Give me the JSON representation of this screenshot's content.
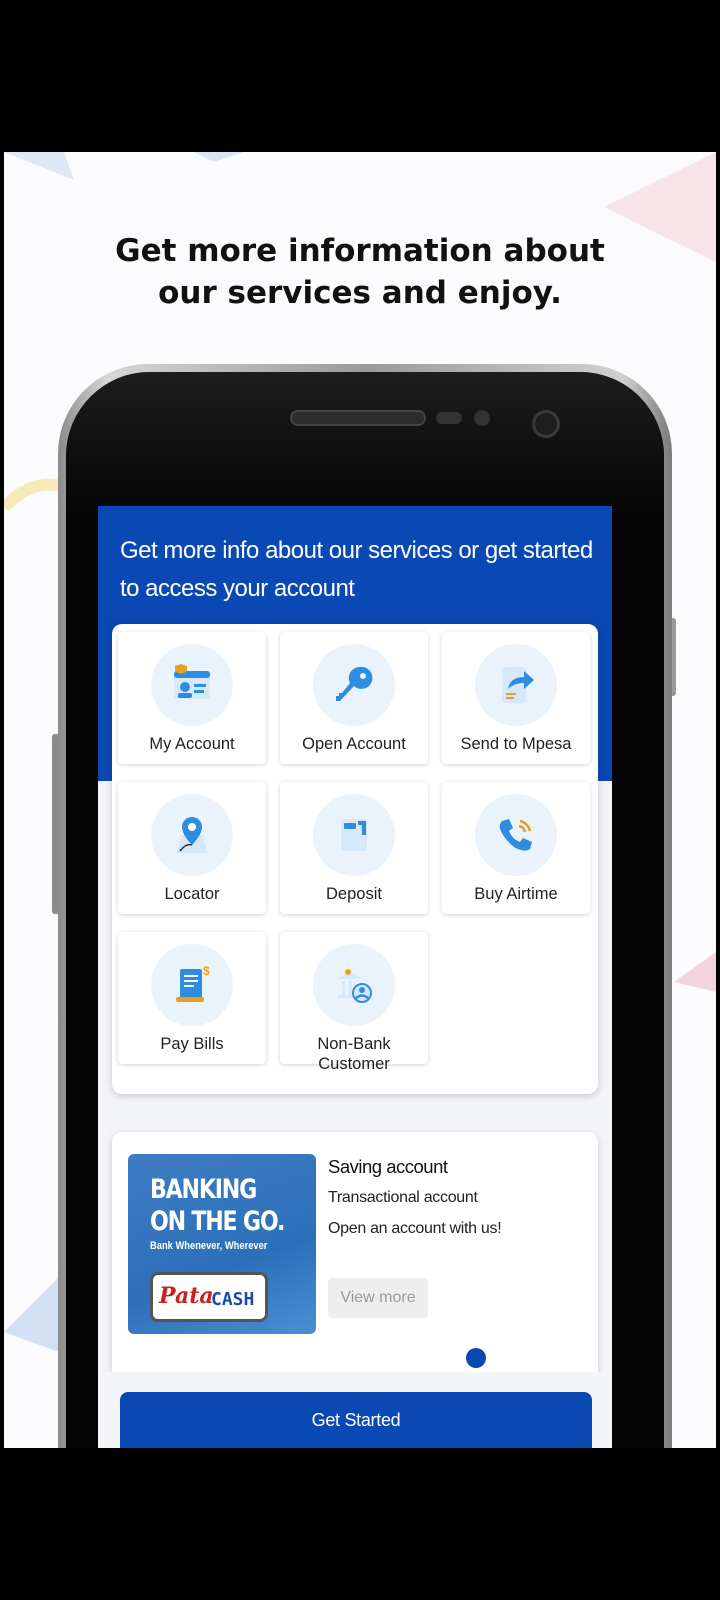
{
  "headline": {
    "line1": "Get more information about",
    "line2": "our services and enjoy."
  },
  "screen": {
    "intro": "Get more info about our services or get started to access your account",
    "services": [
      {
        "label": "My Account",
        "icon": "id-card-icon"
      },
      {
        "label": "Open Account",
        "icon": "key-icon"
      },
      {
        "label": "Send to Mpesa",
        "icon": "share-arrow-icon"
      },
      {
        "label": "Locator",
        "icon": "map-pin-icon"
      },
      {
        "label": "Deposit",
        "icon": "deposit-icon"
      },
      {
        "label": "Buy Airtime",
        "icon": "phone-call-icon"
      },
      {
        "label": "Pay Bills",
        "icon": "bill-icon"
      },
      {
        "label": "Non-Bank Customer",
        "icon": "bank-user-icon"
      }
    ],
    "promo": {
      "banner_line1": "BANKING",
      "banner_line2": "ON THE GO.",
      "banner_tagline": "Bank Whenever, Wherever",
      "logo_part1": "Pata",
      "logo_part2": "CASH",
      "title": "Saving account",
      "subtitle1": "Transactional account",
      "subtitle2": "Open an account with us!",
      "view_more": "View more"
    },
    "get_started": "Get Started"
  },
  "colors": {
    "brand_blue": "#0a49b3",
    "icon_bg": "#eaf3fc",
    "icon_blue": "#2f8de0"
  }
}
